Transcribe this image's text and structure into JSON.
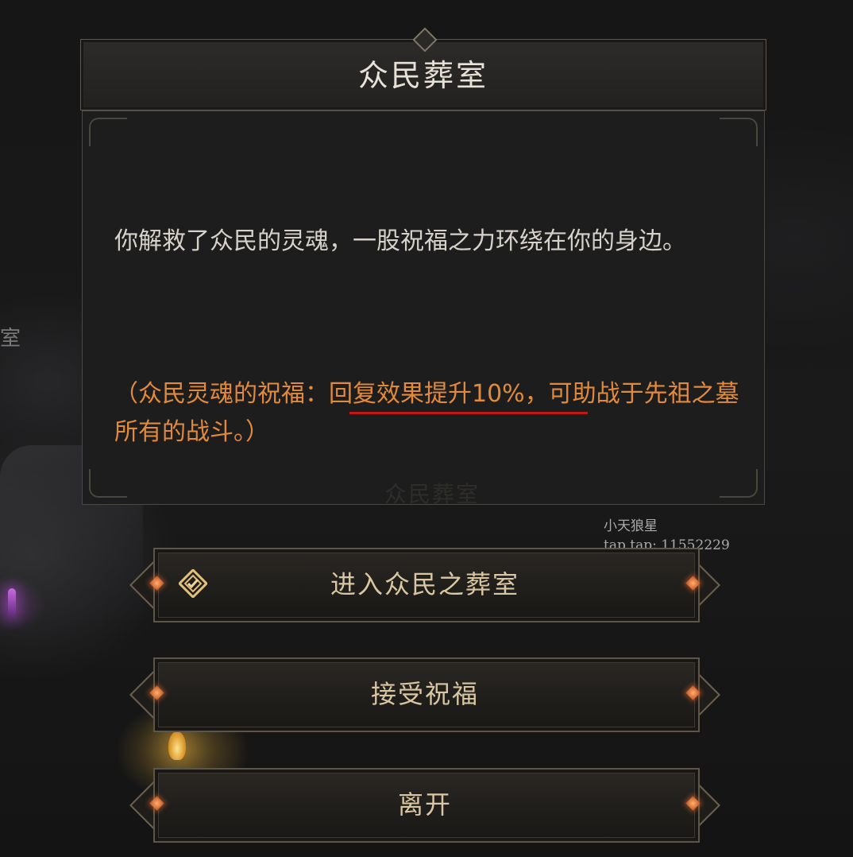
{
  "dialog": {
    "title": "众民葬室",
    "description": "你解救了众民的灵魂，一股祝福之力环绕在你的身边。",
    "blessing": "（众民灵魂的祝福：回复效果提升10%，可助战于先祖之墓所有的战斗。）",
    "ghost_label": "众民葬室"
  },
  "background": {
    "sign_text": "室"
  },
  "watermark": {
    "line1": "小天狼星",
    "line2": "tap tap: 11552229"
  },
  "options": [
    {
      "label": "进入众民之葬室",
      "icon": "diamond-check-icon"
    },
    {
      "label": "接受祝福"
    },
    {
      "label": "离开"
    }
  ],
  "colors": {
    "highlight_text": "#e28a3c",
    "button_text": "#d9c6a2",
    "underline": "#c41616",
    "accent_gem": "#d2662a"
  }
}
